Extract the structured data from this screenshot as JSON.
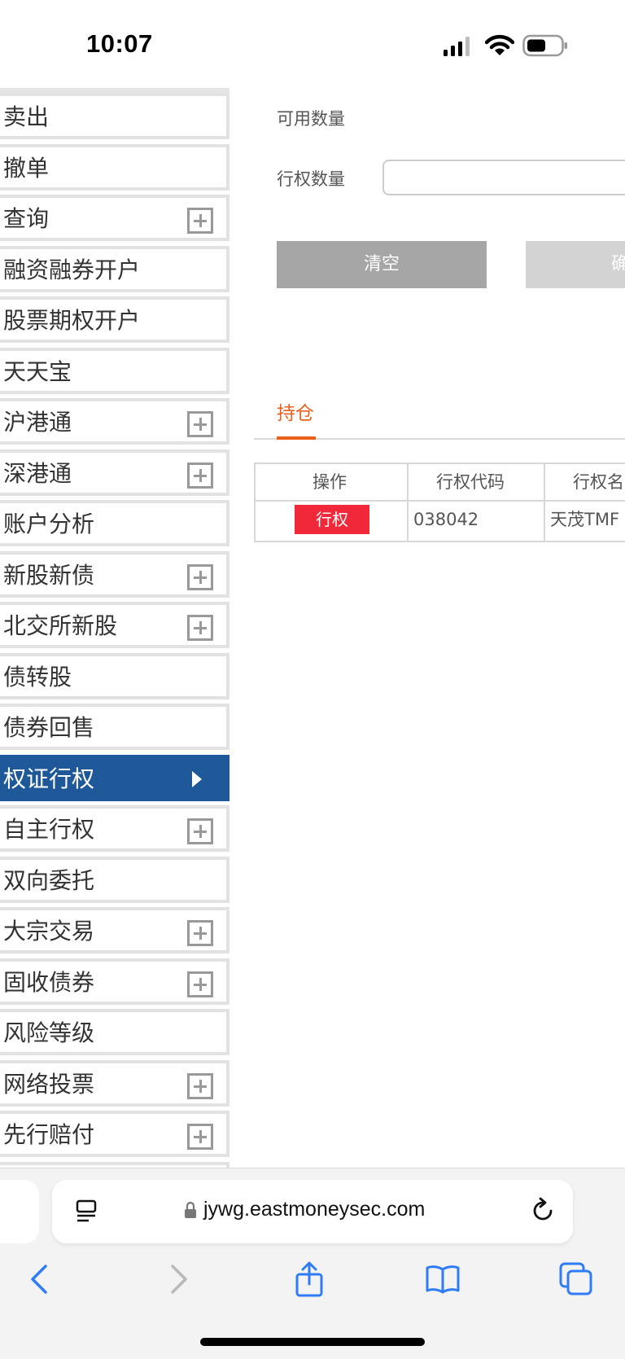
{
  "status": {
    "time": "10:07"
  },
  "sidebar": {
    "items": [
      {
        "label": "卖出",
        "expandable": false
      },
      {
        "label": "撤单",
        "expandable": false
      },
      {
        "label": "查询",
        "expandable": true
      },
      {
        "label": "融资融券开户",
        "expandable": false
      },
      {
        "label": "股票期权开户",
        "expandable": false
      },
      {
        "label": "天天宝",
        "expandable": false
      },
      {
        "label": "沪港通",
        "expandable": true
      },
      {
        "label": "深港通",
        "expandable": true
      },
      {
        "label": "账户分析",
        "expandable": false
      },
      {
        "label": "新股新债",
        "expandable": true
      },
      {
        "label": "北交所新股",
        "expandable": true
      },
      {
        "label": "债转股",
        "expandable": false
      },
      {
        "label": "债券回售",
        "expandable": false
      },
      {
        "label": "权证行权",
        "expandable": false,
        "active": true
      },
      {
        "label": "自主行权",
        "expandable": true
      },
      {
        "label": "双向委托",
        "expandable": false
      },
      {
        "label": "大宗交易",
        "expandable": true
      },
      {
        "label": "固收债券",
        "expandable": true
      },
      {
        "label": "风险等级",
        "expandable": false
      },
      {
        "label": "网络投票",
        "expandable": true
      },
      {
        "label": "先行赔付",
        "expandable": true
      }
    ],
    "active_color": "#1f5898"
  },
  "form": {
    "available_qty_label": "可用数量",
    "exercise_qty_label": "行权数量",
    "exercise_qty_value": "",
    "clear_label": "清空",
    "confirm_label": "确"
  },
  "tabs": {
    "holdings_label": "持仓",
    "accent_color": "#e8601c"
  },
  "table": {
    "headers": [
      "操作",
      "行权代码",
      "行权名"
    ],
    "rows": [
      {
        "action": "行权",
        "code": "038042",
        "name": "天茂TMF"
      }
    ]
  },
  "browser": {
    "url": "jywg.eastmoneysec.com"
  }
}
